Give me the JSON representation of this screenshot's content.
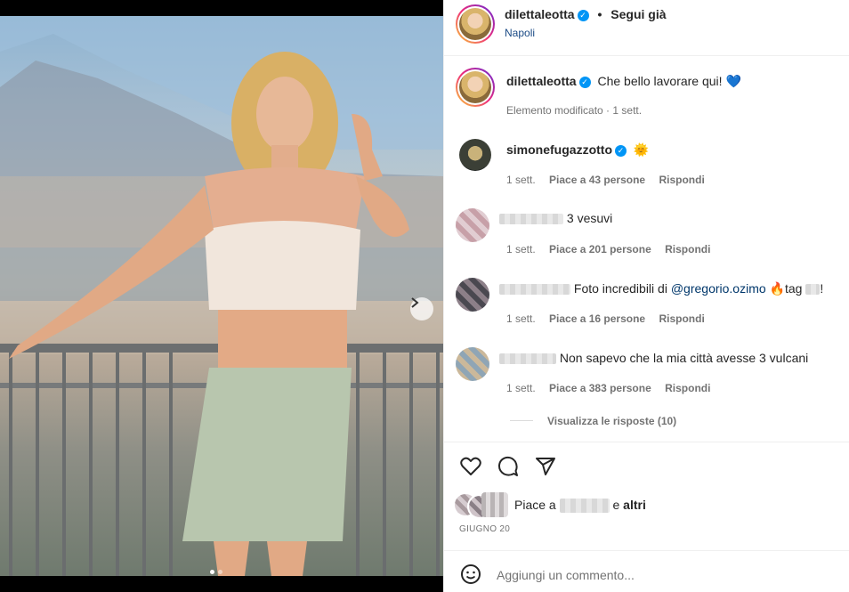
{
  "post": {
    "username": "dilettaleotta",
    "follow_label": "Segui già",
    "location": "Napoli",
    "separator": "•"
  },
  "caption": {
    "username": "dilettaleotta",
    "text": "Che bello lavorare qui!",
    "emoji": "💙",
    "meta": "Elemento modificato · 1 sett."
  },
  "comments": [
    {
      "username": "simonefugazzotto",
      "verified": true,
      "text": "🌞",
      "time": "1 sett.",
      "likes": "Piace a 43 persone",
      "reply": "Rispondi"
    },
    {
      "username": "",
      "text": "3 vesuvi",
      "time": "1 sett.",
      "likes": "Piace a 201 persone",
      "reply": "Rispondi"
    },
    {
      "username": "",
      "text_prefix": "Foto incredibili di",
      "mention": "@gregorio.ozimo",
      "text_suffix": "🔥tag",
      "text_end": "!",
      "time": "1 sett.",
      "likes": "Piace a 16 persone",
      "reply": "Rispondi"
    },
    {
      "username": "",
      "text": "Non sapevo che la mia città avesse 3 vulcani",
      "time": "1 sett.",
      "likes": "Piace a 383 persone",
      "reply": "Rispondi",
      "view_replies": "Visualizza le risposte (10)"
    }
  ],
  "actions": {
    "like_icon": "heart-icon",
    "comment_icon": "comment-icon",
    "share_icon": "share-icon"
  },
  "likes_line": {
    "prefix": "Piace a",
    "middle": "e",
    "suffix": "altri"
  },
  "date": "GIUGNO 20",
  "add_comment": {
    "placeholder": "Aggiungi un commento...",
    "emoji_icon": "smiley-icon"
  },
  "colors": {
    "verified": "#0095f6",
    "text": "#262626",
    "secondary": "#737373",
    "link": "#00376b"
  }
}
